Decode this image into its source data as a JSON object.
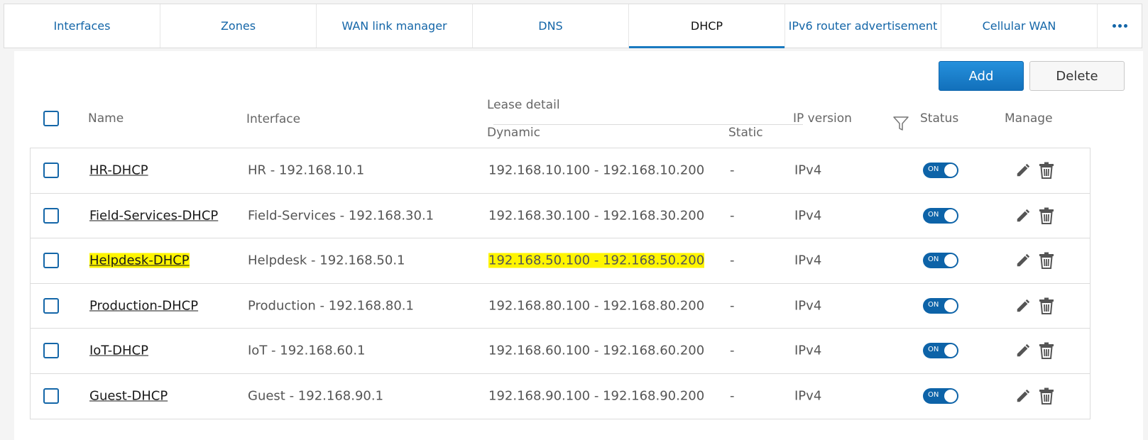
{
  "tabs": [
    {
      "label": "Interfaces"
    },
    {
      "label": "Zones"
    },
    {
      "label": "WAN link manager"
    },
    {
      "label": "DNS"
    },
    {
      "label": "DHCP",
      "active": true
    },
    {
      "label": "IPv6 router advertisement"
    },
    {
      "label": "Cellular WAN"
    }
  ],
  "actions": {
    "add_label": "Add",
    "delete_label": "Delete"
  },
  "columns": {
    "name": "Name",
    "interface": "Interface",
    "lease_detail": "Lease detail",
    "dynamic": "Dynamic",
    "static": "Static",
    "ip_version": "IP version",
    "status": "Status",
    "manage": "Manage"
  },
  "rows": [
    {
      "name": "HR-DHCP",
      "interface": "HR - 192.168.10.1",
      "dynamic": "192.168.10.100 - 192.168.10.200",
      "static": "-",
      "ip_version": "IPv4",
      "status": "ON"
    },
    {
      "name": "Field-Services-DHCP",
      "interface": "Field-Services - 192.168.30.1",
      "dynamic": "192.168.30.100 - 192.168.30.200",
      "static": "-",
      "ip_version": "IPv4",
      "status": "ON"
    },
    {
      "name": "Helpdesk-DHCP",
      "interface": "Helpdesk - 192.168.50.1",
      "dynamic": "192.168.50.100 - 192.168.50.200",
      "static": "-",
      "ip_version": "IPv4",
      "status": "ON",
      "highlighted": true
    },
    {
      "name": "Production-DHCP",
      "interface": "Production - 192.168.80.1",
      "dynamic": "192.168.80.100 - 192.168.80.200",
      "static": "-",
      "ip_version": "IPv4",
      "status": "ON"
    },
    {
      "name": "IoT-DHCP",
      "interface": "IoT - 192.168.60.1",
      "dynamic": "192.168.60.100 - 192.168.60.200",
      "static": "-",
      "ip_version": "IPv4",
      "status": "ON"
    },
    {
      "name": "Guest-DHCP",
      "interface": "Guest - 192.168.90.1",
      "dynamic": "192.168.90.100 - 192.168.90.200",
      "static": "-",
      "ip_version": "IPv4",
      "status": "ON"
    }
  ],
  "colors": {
    "accent": "#1466a8",
    "highlight": "#fff500",
    "toggle_on": "#0d63a8"
  }
}
